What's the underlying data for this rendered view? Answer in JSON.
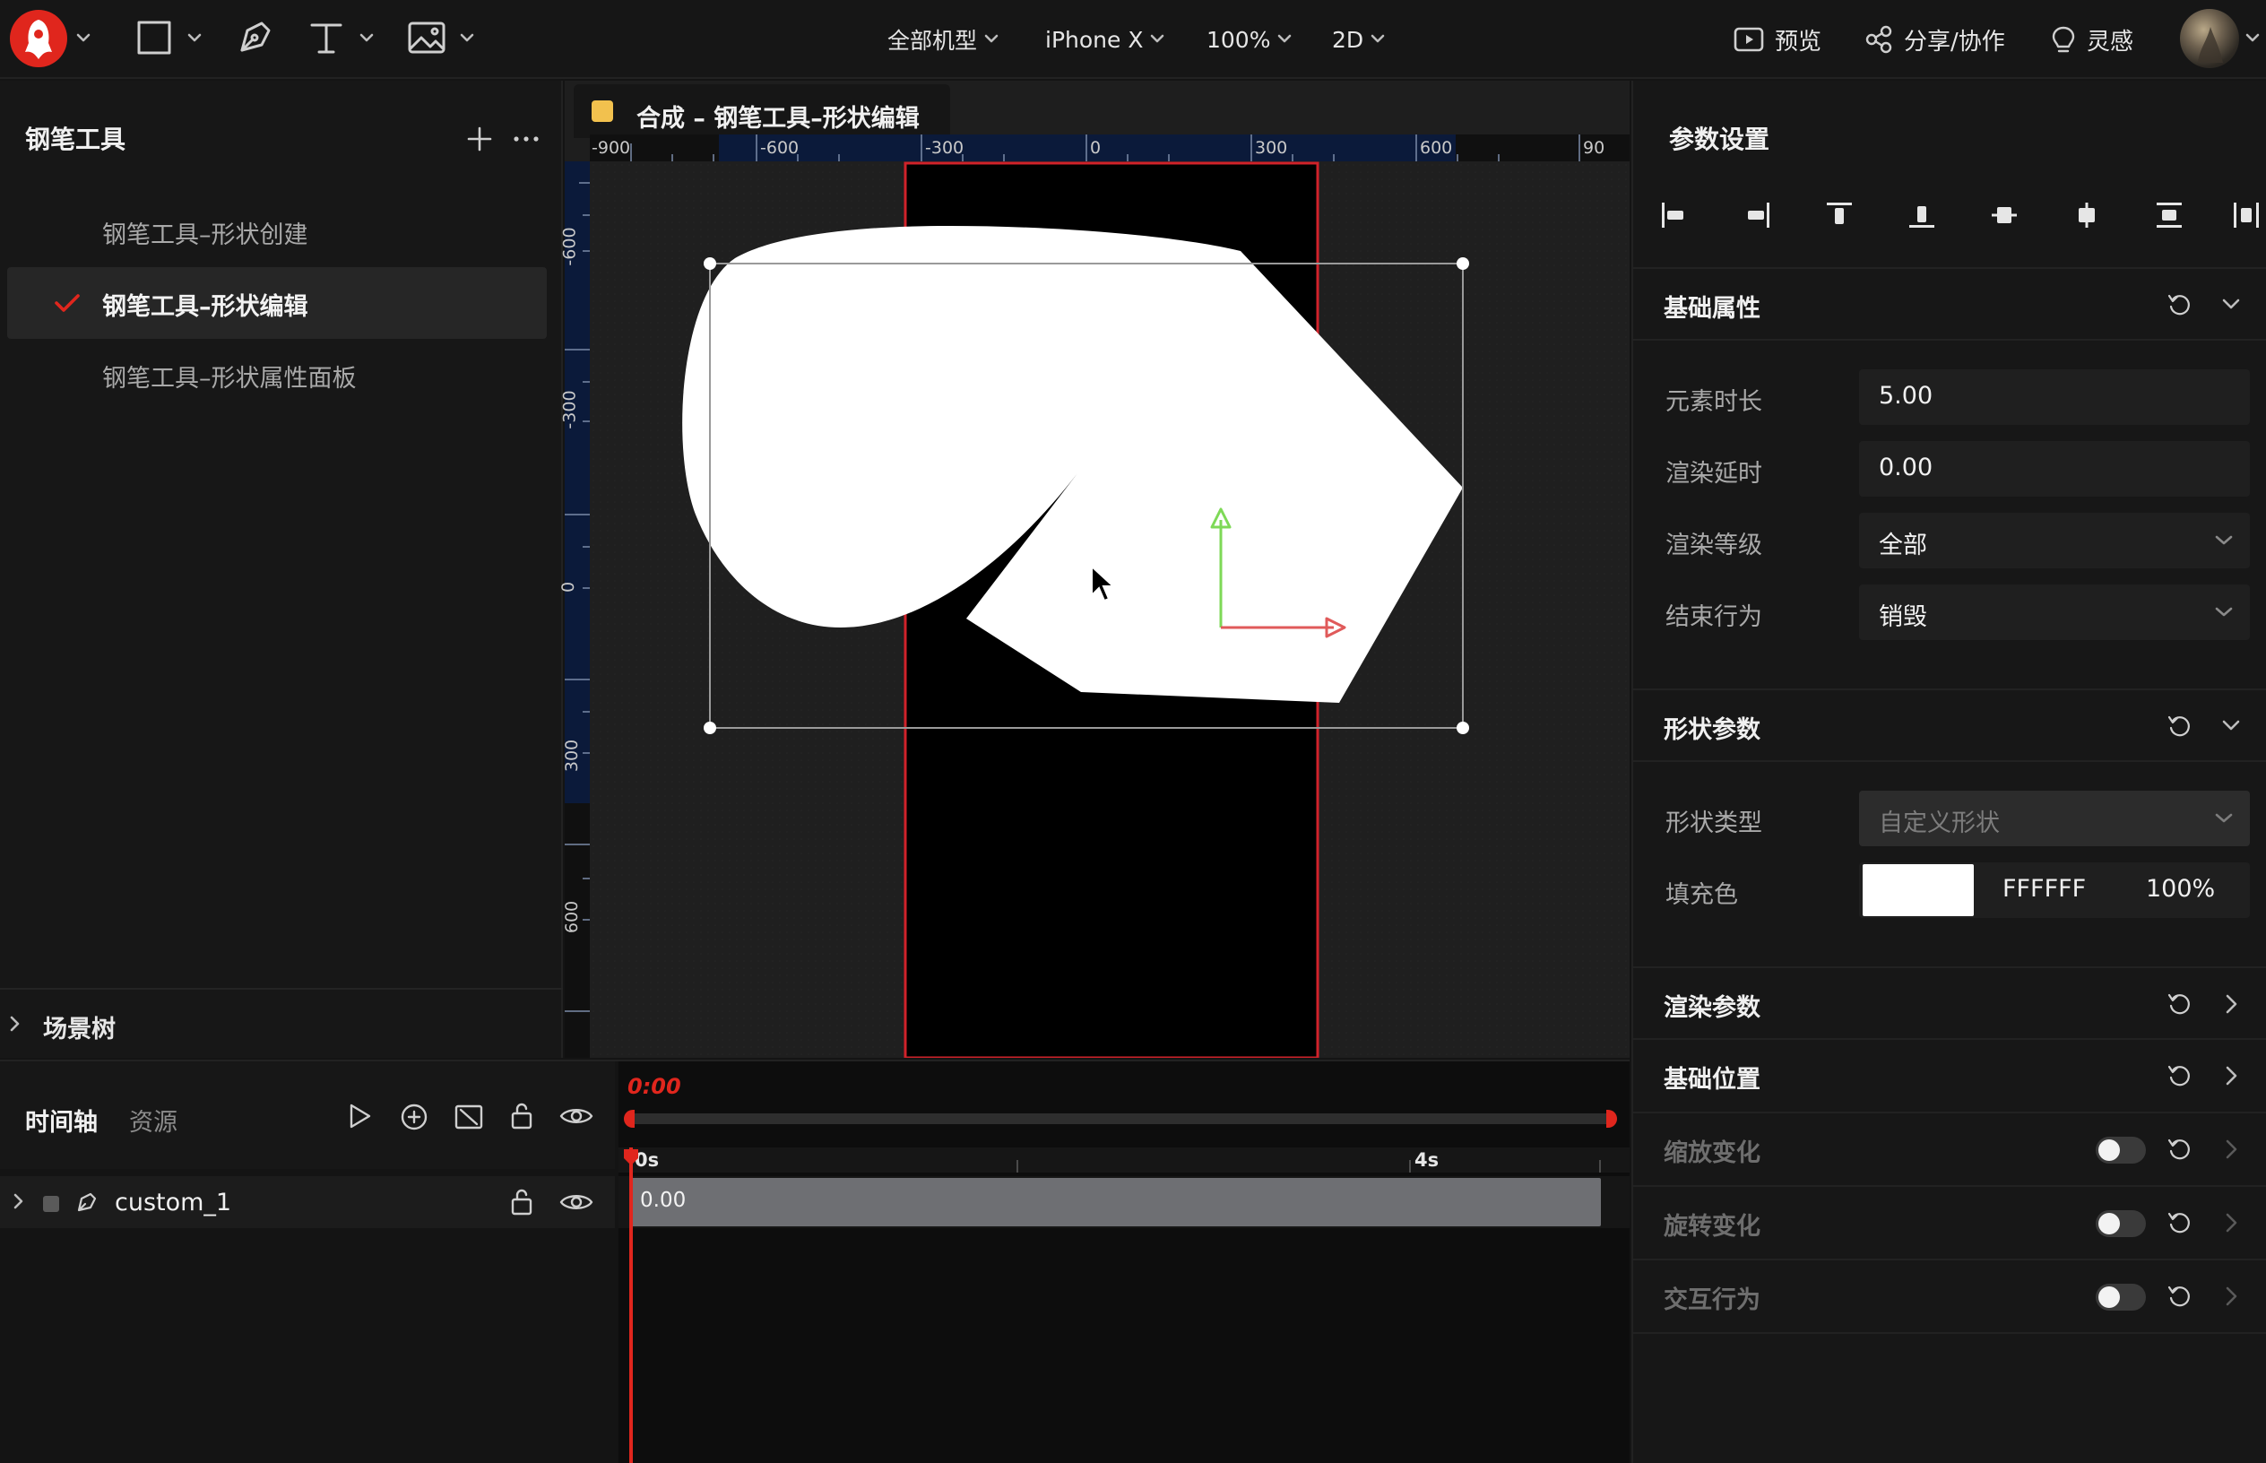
{
  "app": {
    "toolbar": {
      "device_filter": "全部机型",
      "device": "iPhone X",
      "zoom": "100%",
      "mode": "2D",
      "preview": "预览",
      "share": "分享/协作",
      "inspiration": "灵感"
    }
  },
  "left_panel": {
    "title": "钢笔工具",
    "items": [
      {
        "label": "钢笔工具–形状创建",
        "active": false
      },
      {
        "label": "钢笔工具–形状编辑",
        "active": true
      },
      {
        "label": "钢笔工具–形状属性面板",
        "active": false
      }
    ],
    "scene_tree": "场景树"
  },
  "canvas": {
    "tab_title": "合成 – 钢笔工具–形状编辑",
    "tab_color": "#f2c14e",
    "ruler_h": [
      "-900",
      "-600",
      "-300",
      "0",
      "300",
      "600",
      "90"
    ],
    "ruler_v": [
      "-600",
      "-300",
      "0",
      "300",
      "600"
    ],
    "shape_fill": "#FFFFFF",
    "artboard_border": "#d0222a"
  },
  "timeline": {
    "tab_active": "时间轴",
    "tab_inactive": "资源",
    "current_time": "0:00",
    "marker_0": "0s",
    "marker_4": "4s",
    "layer_name": "custom_1",
    "clip_value": "0.00",
    "accent": "#e0261d"
  },
  "right_panel": {
    "title": "参数设置",
    "basic": {
      "title": "基础属性",
      "fields": [
        {
          "label": "元素时长",
          "value": "5.00"
        },
        {
          "label": "渲染延时",
          "value": "0.00"
        },
        {
          "label": "渲染等级",
          "value": "全部"
        },
        {
          "label": "结束行为",
          "value": "销毁"
        }
      ]
    },
    "shape": {
      "title": "形状参数",
      "type_label": "形状类型",
      "type_value": "自定义形状",
      "fill_label": "填充色",
      "fill_hex": "FFFFFF",
      "fill_opacity": "100%"
    },
    "sections": [
      {
        "label": "渲染参数"
      },
      {
        "label": "基础位置"
      },
      {
        "label": "缩放变化"
      },
      {
        "label": "旋转变化"
      },
      {
        "label": "交互行为"
      }
    ]
  }
}
